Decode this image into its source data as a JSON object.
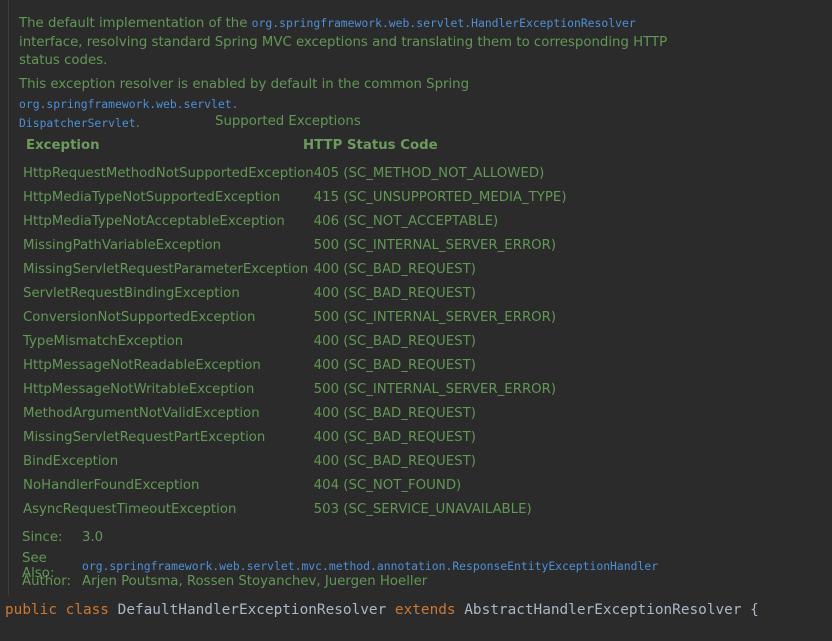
{
  "doc": {
    "para1_text_a": "The default implementation of the ",
    "para1_code": "org.springframework.web.servlet.HandlerExceptionResolver",
    "para1_text_b": " interface, resolving standard Spring MVC exceptions and translating them to corresponding HTTP status codes.",
    "para2_text_a": "This exception resolver is enabled by default in the common Spring ",
    "para2_code_a": "org.springframework.web.servlet.",
    "para2_code_b": "DispatcherServlet",
    "para2_text_b": ".",
    "table_caption": "Supported Exceptions",
    "col_exception": "Exception",
    "col_status": "HTTP Status Code",
    "rows": [
      {
        "exception": "HttpRequestMethodNotSupportedException",
        "status": "405 (SC_METHOD_NOT_ALLOWED)"
      },
      {
        "exception": "HttpMediaTypeNotSupportedException",
        "status": "415 (SC_UNSUPPORTED_MEDIA_TYPE)"
      },
      {
        "exception": "HttpMediaTypeNotAcceptableException",
        "status": "406 (SC_NOT_ACCEPTABLE)"
      },
      {
        "exception": "MissingPathVariableException",
        "status": "500 (SC_INTERNAL_SERVER_ERROR)"
      },
      {
        "exception": "MissingServletRequestParameterException",
        "status": "400 (SC_BAD_REQUEST)"
      },
      {
        "exception": "ServletRequestBindingException",
        "status": "400 (SC_BAD_REQUEST)"
      },
      {
        "exception": "ConversionNotSupportedException",
        "status": "500 (SC_INTERNAL_SERVER_ERROR)"
      },
      {
        "exception": "TypeMismatchException",
        "status": "400 (SC_BAD_REQUEST)"
      },
      {
        "exception": "HttpMessageNotReadableException",
        "status": "400 (SC_BAD_REQUEST)"
      },
      {
        "exception": "HttpMessageNotWritableException",
        "status": "500 (SC_INTERNAL_SERVER_ERROR)"
      },
      {
        "exception": "MethodArgumentNotValidException",
        "status": "400 (SC_BAD_REQUEST)"
      },
      {
        "exception": "MissingServletRequestPartException",
        "status": "400 (SC_BAD_REQUEST)"
      },
      {
        "exception": "BindException",
        "status": "400 (SC_BAD_REQUEST)"
      },
      {
        "exception": "NoHandlerFoundException",
        "status": "404 (SC_NOT_FOUND)"
      },
      {
        "exception": "AsyncRequestTimeoutException",
        "status": "503 (SC_SERVICE_UNAVAILABLE)"
      }
    ],
    "since_label": "Since:",
    "since_value": "3.0",
    "see_also_label": "See Also:",
    "see_also_value": "org.springframework.web.servlet.mvc.method.annotation.ResponseEntityExceptionHandler",
    "author_label": "Author:",
    "author_value": "Arjen Poutsma, Rossen Stoyanchev, Juergen Hoeller"
  },
  "code": {
    "kw_public": "public",
    "kw_class": "class",
    "class_name": "DefaultHandlerExceptionResolver",
    "kw_extends": "extends",
    "super_name": "AbstractHandlerExceptionResolver",
    "brace": "{"
  },
  "colors": {
    "background": "#2b2b2b",
    "doc_text": "#629755",
    "doc_code": "#4f8fd6",
    "keyword": "#cc7832",
    "identifier": "#a9b7c6"
  }
}
